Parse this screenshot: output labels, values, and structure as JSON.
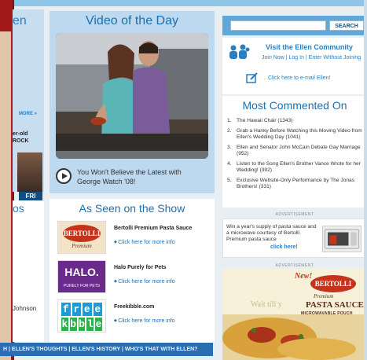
{
  "left_column": {
    "header_partial": "en",
    "more_label": "MORE »",
    "snippet_line1": "er-old",
    "snippet_line2": "ROCK",
    "fri_label": "FRI",
    "section2_header_partial": "os",
    "johnson_text": "Johnson"
  },
  "video": {
    "title": "Video of the Day",
    "caption_line1": "You Won't Believe the Latest with",
    "caption_line2": "George Watch '08!"
  },
  "as_seen": {
    "title": "As Seen on the Show",
    "items": [
      {
        "name": "Bertolli Premium Pasta Sauce",
        "link": "Click here for more info",
        "logo_text": "BERTOLLI",
        "logo_sub": "Premium",
        "logo_sub2": "PASTA SAUCE"
      },
      {
        "name": "Halo Purely for Pets",
        "link": "Click here for more info",
        "logo_text": "HALO.",
        "logo_sub": "PURELY FOR PETS"
      },
      {
        "name": "Freekibble.com",
        "link": "Click here for more info",
        "logo_row1": [
          "f",
          "r",
          "e",
          "e"
        ],
        "logo_row2": [
          "k",
          "b",
          "b",
          "l",
          "e"
        ]
      }
    ]
  },
  "bottom_nav": {
    "text": "H  |  ELLEN'S THOUGHTS  |  ELLEN'S HISTORY  |  WHO'S THAT WITH ELLEN?"
  },
  "search": {
    "button_label": "SEARCH",
    "placeholder": ""
  },
  "community": {
    "title": "Visit the Ellen Community",
    "links": "Join Now | Log In | Enter Without Joining",
    "email": "Click here to e-mail Ellen!"
  },
  "most_commented": {
    "title": "Most Commented On",
    "items": [
      {
        "num": "1.",
        "text": "The Hawaii Chair (1343)"
      },
      {
        "num": "2.",
        "text": "Grab a Hanky Before Watching this Moving Video from Ellen's Wedding Day (1041)"
      },
      {
        "num": "3.",
        "text": "Ellen and Senator John McCain Debate Gay Marriage (952)"
      },
      {
        "num": "4.",
        "text": "Listen to the Song Ellen's Brother Vance Wrote for her Wedding! (392)"
      },
      {
        "num": "5.",
        "text": "Exclusive Website-Only Performance by The Jonas Brothers! (331)"
      }
    ]
  },
  "ads": {
    "label": "ADVERTISEMENT",
    "ad1_text": "Win a year's supply of pasta sauce and a microwave courtesy of Bertolli Premium pasta sauce",
    "ad1_click": "click here!",
    "ad2_new": "New!",
    "ad2_brand": "BERTOLLI",
    "ad2_premium": "Premium",
    "ad2_product": "PASTA SAUCE",
    "ad2_pouch": "MICROWAVABLE POUCH",
    "ad2_tagline": "Wait till y"
  }
}
